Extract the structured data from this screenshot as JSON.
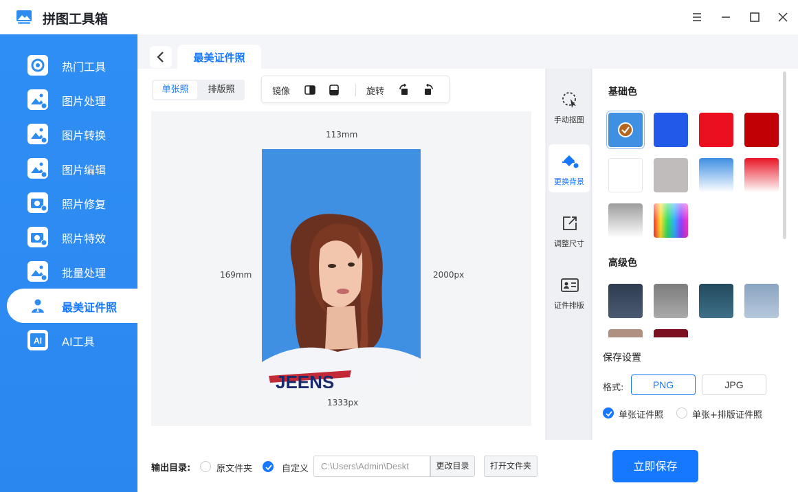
{
  "app": {
    "title": "拼图工具箱"
  },
  "sidebar": {
    "items": [
      {
        "label": "热门工具",
        "icon": "hot-tools-icon"
      },
      {
        "label": "图片处理",
        "icon": "image-process-icon"
      },
      {
        "label": "图片转换",
        "icon": "image-convert-icon"
      },
      {
        "label": "图片编辑",
        "icon": "image-edit-icon"
      },
      {
        "label": "照片修复",
        "icon": "photo-repair-icon"
      },
      {
        "label": "照片特效",
        "icon": "photo-effect-icon"
      },
      {
        "label": "批量处理",
        "icon": "batch-icon"
      },
      {
        "label": "最美证件照",
        "icon": "id-photo-icon",
        "active": true
      },
      {
        "label": "AI工具",
        "icon": "ai-icon"
      }
    ]
  },
  "tab": {
    "title": "最美证件照"
  },
  "mode": {
    "single": "单张照",
    "layout": "排版照"
  },
  "toolbar": {
    "mirror": "镜像",
    "rotate": "旋转"
  },
  "canvas": {
    "width_mm": "113mm",
    "height_mm": "169mm",
    "height_px": "2000px",
    "width_px": "1333px",
    "background": "#3f8fe3"
  },
  "tools": [
    {
      "label": "手动抠图",
      "icon": "manual-cutout-icon"
    },
    {
      "label": "更换背景",
      "icon": "paint-bucket-icon",
      "active": true
    },
    {
      "label": "调整尺寸",
      "icon": "resize-icon"
    },
    {
      "label": "证件排版",
      "icon": "id-layout-icon"
    }
  ],
  "basic_colors": {
    "title": "基础色",
    "colors": [
      "#3f8fe3",
      "#2359e8",
      "#ea1020",
      "#c10005",
      "#ffffff",
      "#c0bcbc",
      "gradient-blue",
      "gradient-red",
      "gradient-gray",
      "gradient-rainbow"
    ]
  },
  "advanced_colors": {
    "title": "高级色",
    "colors": [
      "#3a4a5e",
      "#8d8d8d",
      "#2d5a70",
      "#9ab3cc",
      "#b09080",
      "#7a1020"
    ]
  },
  "save_settings": {
    "title": "保存设置",
    "format_label": "格式:",
    "formats": [
      "PNG",
      "JPG"
    ],
    "selected_format": "PNG",
    "option_single": "单张证件照",
    "option_both": "单张+排版证件照"
  },
  "output": {
    "label": "输出目录:",
    "opt_original": "原文件夹",
    "opt_custom": "自定义",
    "path": "C:\\Users\\Admin\\Deskt",
    "change_dir": "更改目录",
    "open_folder": "打开文件夹",
    "save": "立即保存"
  }
}
